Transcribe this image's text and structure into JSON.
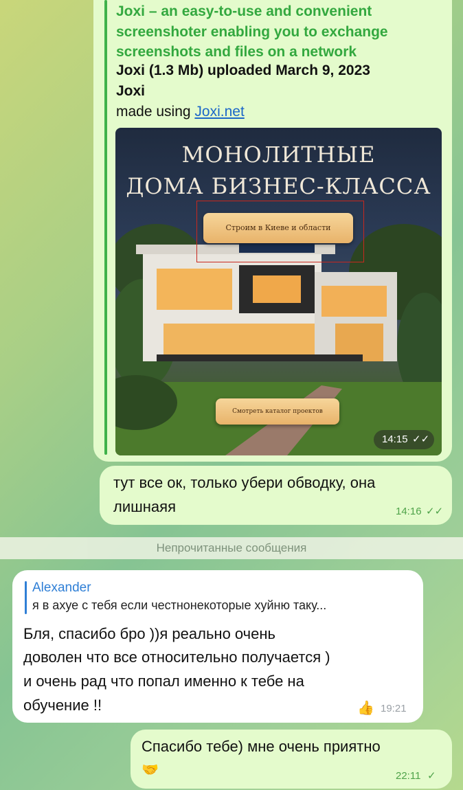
{
  "link_preview": {
    "title": "Joxi – an easy-to-use and convenient screenshoter enabling you to exchange screenshots and files on a network",
    "upload_line": "Joxi (1.3 Mb) uploaded March 9, 2023",
    "site_name": "Joxi",
    "made_using_prefix": "made using ",
    "made_using_link": "Joxi.net",
    "image": {
      "title_line1": "МОНОЛИТНЫЕ",
      "title_line2": "ДОМА БИЗНЕС-КЛАССА",
      "button_top": "Строим в Киеве и области",
      "button_bottom": "Смотреть каталог проектов"
    },
    "time": "14:15",
    "status": "read"
  },
  "messages": [
    {
      "direction": "out",
      "text_line1": "тут все ок, только убери обводку, она",
      "text_line2": "лишнаяя",
      "time": "14:16",
      "status": "read"
    },
    {
      "direction": "in",
      "reply_to_name": "Alexander",
      "reply_to_text": "я в ахуе с тебя если честнонекоторые хуйню таку...",
      "text_line1": "Бля, спасибо бро ))я реально очень",
      "text_line2": "доволен что все относительно получается )",
      "text_line3": "и очень рад что попал именно к тебе на",
      "text_line4": "обучение !!",
      "reaction": "👍",
      "time": "19:21"
    },
    {
      "direction": "out",
      "text_line1": "Спасибо тебе) мне очень приятно",
      "emoji": "🤝",
      "time": "22:11",
      "status": "sent"
    }
  ],
  "divider_label": "Непрочитанные сообщения",
  "colors": {
    "outgoing_bubble": "#e4fbcc",
    "incoming_bubble": "#ffffff",
    "link_title": "#33a83f",
    "reply_accent": "#2f7fd6",
    "outgoing_time": "#4fa34a"
  }
}
